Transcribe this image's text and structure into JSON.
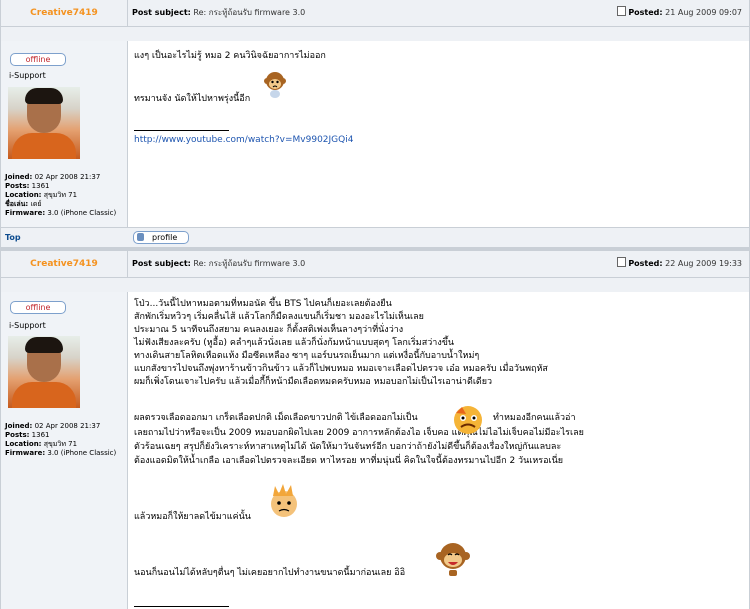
{
  "posts": [
    {
      "author": "Creative7419",
      "subject_label": "Post subject:",
      "subject": "Re: กระทู้ถ้อนรับ firmware 3.0",
      "posted_label": "Posted:",
      "posted": "21 Aug 2009 09:07",
      "status": "offline",
      "role": "i-Support",
      "joined_label": "Joined:",
      "joined": "02 Apr 2008 21:37",
      "posts_label": "Posts:",
      "posts": "1361",
      "location_label": "Location:",
      "location": "สุขุมวิท 71",
      "name_label": "ชื่อเล่น:",
      "name": "เดย์",
      "firmware_label": "Firmware:",
      "firmware": "3.0 (iPhone Classic)",
      "lines": [
        "แงๆ เป็นอะไรไม่รู้ หมอ 2 คนวินิจฉัยอาการไม่ออก",
        "ทรมานจัง นัดให้ไปหาพรุ่งนี้อีก"
      ],
      "signature_link": "http://www.youtube.com/watch?v=Mv9902JGQi4",
      "top_link": "Top",
      "profile_button": "profile"
    },
    {
      "author": "Creative7419",
      "subject_label": "Post subject:",
      "subject": "Re: กระทู้ถ้อนรับ firmware 3.0",
      "posted_label": "Posted:",
      "posted": "22 Aug 2009 19:33",
      "status": "offline",
      "role": "i-Support",
      "joined_label": "Joined:",
      "joined": "02 Apr 2008 21:37",
      "posts_label": "Posts:",
      "posts": "1361",
      "location_label": "Location:",
      "location": "สุขุมวิท 71",
      "firmware_label": "Firmware:",
      "firmware": "3.0 (iPhone Classic)",
      "paragraph1": [
        "โป่ว...วันนี้ไปหาหมอตามที่หมอนัด ขึ้น BTS ไปคนก็เยอะเลยต้องยืน",
        "สักพักเริ่มหวิวๆ เริ่มคลื่นไส้ แล้วโลกก็มืดลงแขนก็เริ่มชา มองอะไรไม่เห็นเลย",
        "ประมาณ 5 นาทีจนถึงสยาม คนลงเยอะ ก็ตั้งสติเพ่งเห็นลางๆว่าที่นั่งว่าง",
        "ไม่ฟังเสียงละครับ (หูอื้อ) คลำๆแล้วนั่งเลย แล้วก็นั่งก้มหน้าแบบสุดๆ โลกเริ่มสว่างขึ้น",
        "ทางเดินสายโลหิตเหือดแห้ง มือซีดเหลือง ซาๆ แอร์บนรถเย็นมาก แต่เหงื่อนี้กับอาบน้ำใหม่ๆ",
        "แบกสังขารไปจนถึงพุ่งหาร้านข้าวกินข้าว แล้วก็ไปพบหมอ หมอเจาะเลือดไปตรวจ เอ๋อ หมอครับ เมื่อวันพฤหัส",
        "ผมก็เพิ่งโดนเจาะไปครับ แล้วเมื่อกี้ก็หน้ามืดเลือดหมดครับหมอ หมอบอกไม่เป็นไรเอาน่าดีเดียว"
      ],
      "paragraph2": [
        "ผลตรวจเลือดออกมา เกร็ดเลือดปกติ เม็ดเลือดขาวปกติ ไข้เลือดออกไม่เป็น",
        "เลยถามไปว่าหรือจะเป็น 2009 หมอบอกผิดไปเลย 2009 อาการหลักต้องไอ เจ็บคอ แต่คุณไม่ไอไม่เจ็บคอไม่มีอะไรเลย",
        "ตัวร้อนเฉยๆ สรุปก็ยังวิเคราะห์หาสาเหตุไม่ได้ นัดให้มาวันจันทร์อีก บอกว่าถ้ายังไม่ดีขึ้นก็ต้องเรื่องใหญ่กันแลบละ",
        "ต้องแอดมิตให้น้ำเกลือ เอาเลือดไปตรวจละเอียด หาไหรอย หาที่มนุ่นนี่ คิดในใจนี้ต้องทรมานไปอีก 2 วันเหรอเนี่ย"
      ],
      "paragraph2_tail": "ทำหมองอีกคนแล้วอ่า",
      "line_sick": "แล้วหมอก็ให้ยาลดไข้มาแค่นั้น",
      "line_sleep": "นอนก็นอนไม่ได้หลับๆตื่นๆ ไม่เคยอยากไปทำงานขนาดนี้มาก่อนเลย อิอิ"
    }
  ]
}
